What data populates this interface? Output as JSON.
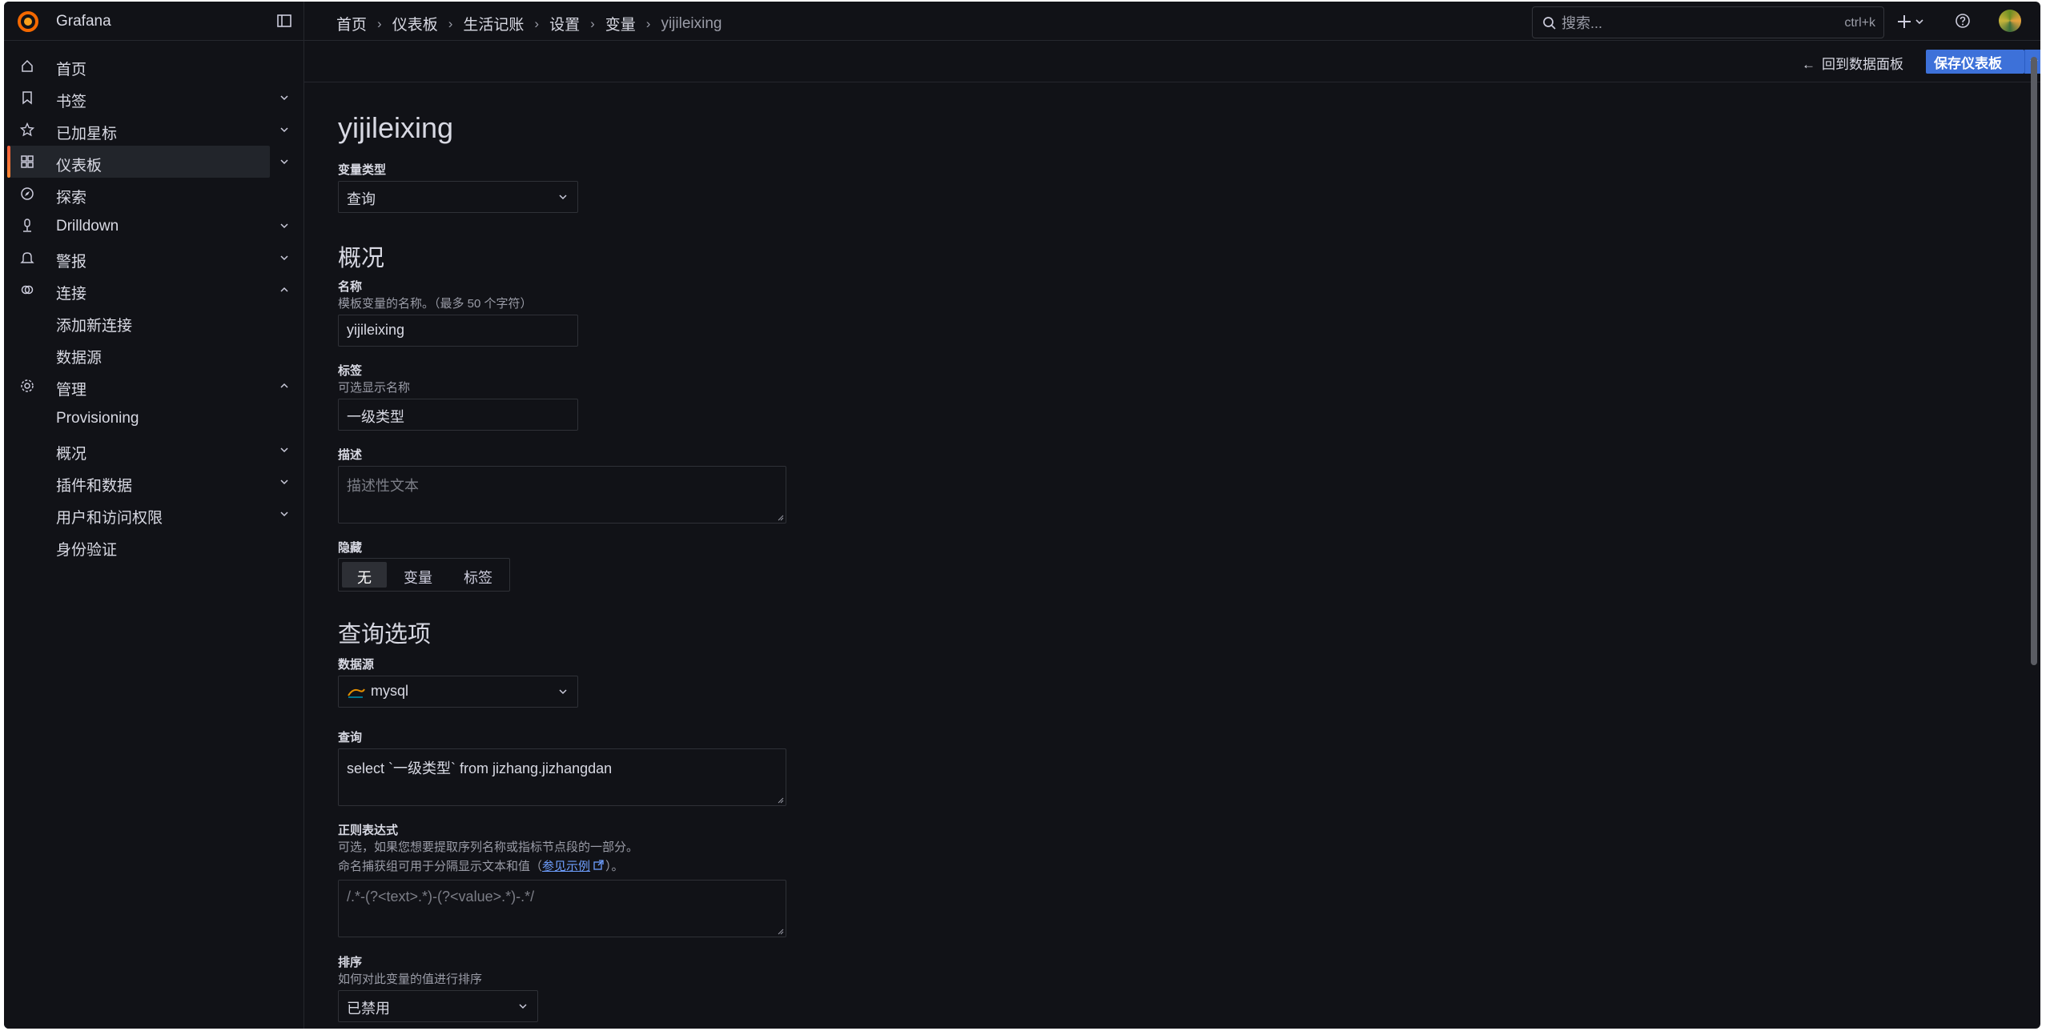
{
  "app": {
    "brand": "Grafana"
  },
  "breadcrumb": [
    "首页",
    "仪表板",
    "生活记账",
    "设置",
    "变量",
    "yijileixing"
  ],
  "search": {
    "placeholder": "搜索...",
    "shortcut": "ctrl+k"
  },
  "sidebar": {
    "items": [
      {
        "label": "首页",
        "icon": "home-icon"
      },
      {
        "label": "书签",
        "icon": "bookmark-icon",
        "chevron": "down"
      },
      {
        "label": "已加星标",
        "icon": "star-icon",
        "chevron": "down"
      },
      {
        "label": "仪表板",
        "icon": "dashboards-grid-icon",
        "chevron": "down",
        "active": true
      },
      {
        "label": "探索",
        "icon": "compass-icon"
      },
      {
        "label": "Drilldown",
        "icon": "drilldown-icon",
        "chevron": "down"
      },
      {
        "label": "警报",
        "icon": "bell-icon",
        "chevron": "down"
      },
      {
        "label": "连接",
        "icon": "link-icon",
        "chevron": "up"
      },
      {
        "label": "添加新连接",
        "sub": true
      },
      {
        "label": "数据源",
        "sub": true
      },
      {
        "label": "管理",
        "icon": "gear-icon",
        "chevron": "up"
      },
      {
        "label": "Provisioning",
        "sub": true
      },
      {
        "label": "概况",
        "sub": true,
        "chevron": "down"
      },
      {
        "label": "插件和数据",
        "sub": true,
        "chevron": "down"
      },
      {
        "label": "用户和访问权限",
        "sub": true,
        "chevron": "down"
      },
      {
        "label": "身份验证",
        "sub": true
      }
    ]
  },
  "toolbar": {
    "back_label": "回到数据面板",
    "save_label": "保存仪表板"
  },
  "form": {
    "title": "yijileixing",
    "var_type_label": "变量类型",
    "var_type_value": "查询",
    "overview_heading": "概况",
    "name_label": "名称",
    "name_desc": "模板变量的名称。（最多 50 个字符）",
    "name_value": "yijileixing",
    "tag_label": "标签",
    "tag_desc": "可选显示名称",
    "tag_value": "一级类型",
    "desc_label": "描述",
    "desc_placeholder": "描述性文本",
    "hide_label": "隐藏",
    "hide_options": [
      "无",
      "变量",
      "标签"
    ],
    "hide_selected": "无",
    "query_heading": "查询选项",
    "datasource_label": "数据源",
    "datasource_value": "mysql",
    "query_label": "查询",
    "query_value": "select `一级类型` from jizhang.jizhangdan",
    "regex_label": "正则表达式",
    "regex_desc1": "可选，如果您想要提取序列名称或指标节点段的一部分。",
    "regex_desc2_pre": "命名捕获组可用于分隔显示文本和值（",
    "regex_link": "参见示例",
    "regex_desc2_post": "）。",
    "regex_placeholder": "/.*-(?<text>.*)-(?<value>.*)-.*/",
    "sort_label": "排序",
    "sort_desc": "如何对此变量的值进行排序",
    "sort_value": "已禁用"
  },
  "colors": {
    "accent": "#3d71d9",
    "active_bar": "#f55f3e",
    "background": "#111217"
  }
}
